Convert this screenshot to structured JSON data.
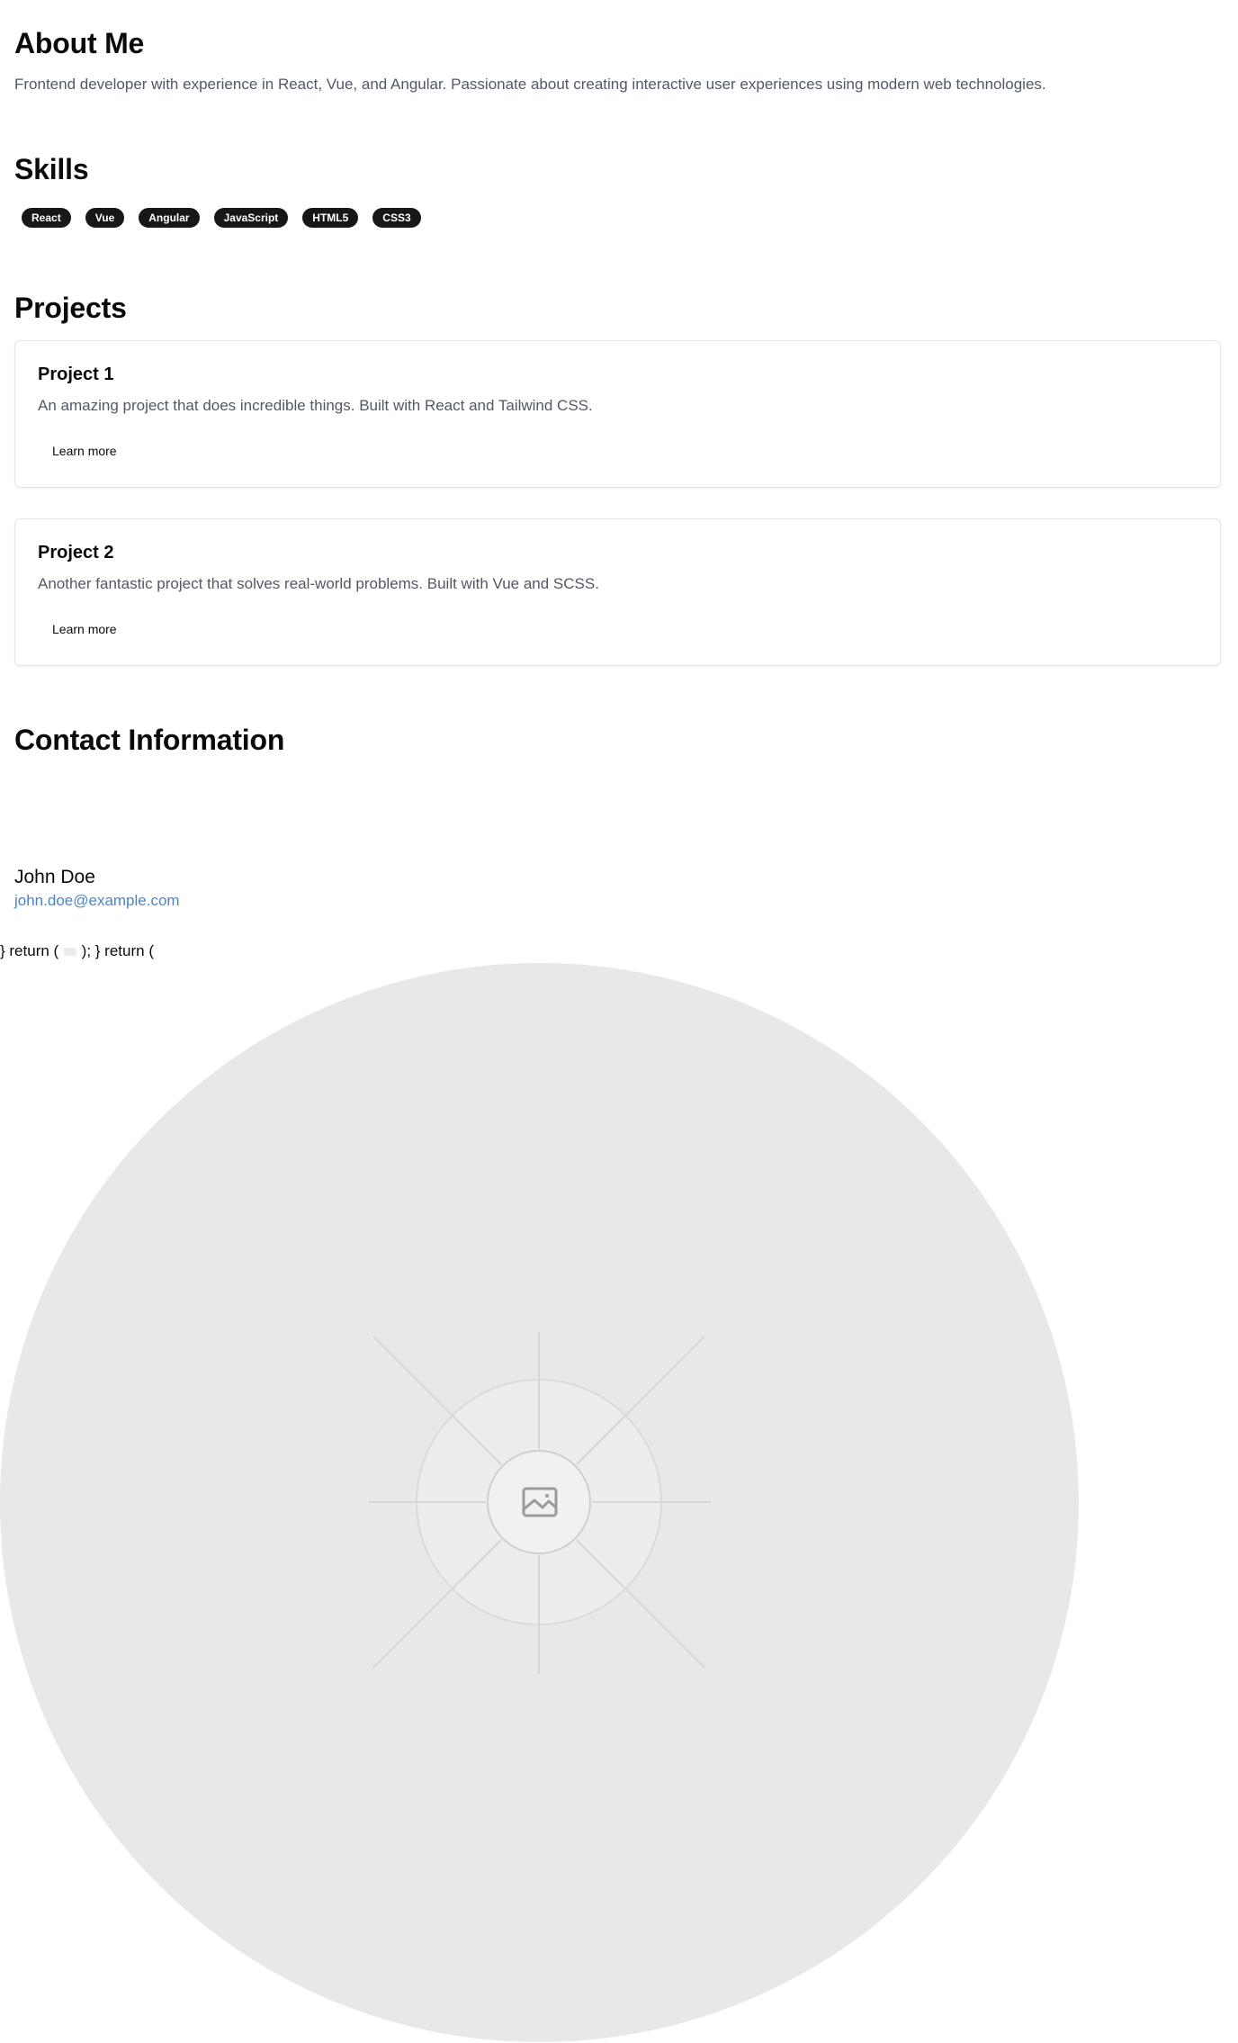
{
  "about": {
    "title": "About Me",
    "text": "Frontend developer with experience in React, Vue, and Angular. Passionate about creating interactive user experiences using modern web technologies."
  },
  "skills": {
    "title": "Skills",
    "items": [
      "React",
      "Vue",
      "Angular",
      "JavaScript",
      "HTML5",
      "CSS3"
    ]
  },
  "projects": {
    "title": "Projects",
    "items": [
      {
        "title": "Project 1",
        "description": "An amazing project that does incredible things. Built with React and Tailwind CSS.",
        "button_label": "Learn more"
      },
      {
        "title": "Project 2",
        "description": "Another fantastic project that solves real-world problems. Built with Vue and SCSS.",
        "button_label": "Learn more"
      }
    ]
  },
  "contact": {
    "title": "Contact Information",
    "name": "John Doe",
    "email": "john.doe@example.com"
  },
  "stray_code": {
    "before": "} return (",
    "after": "); } return ("
  },
  "placeholder_image": {
    "icon": "image-icon"
  },
  "colors": {
    "badge_bg": "#171717",
    "muted_text": "#525866",
    "link": "#4a86c7",
    "placeholder_bg": "#e8e8e8"
  }
}
